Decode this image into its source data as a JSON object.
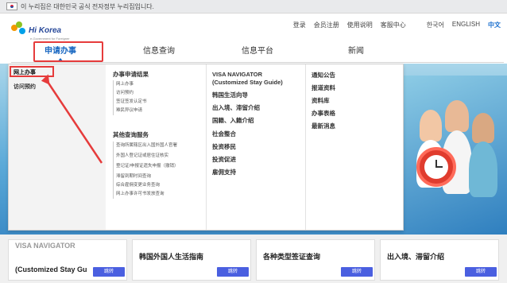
{
  "gov_bar": {
    "text": "이 누리집은 대한민국 공식 전자정부 누리집입니다."
  },
  "logo": {
    "brand": "Hi Korea",
    "tagline": "e-Government for Foreigner"
  },
  "util_links": [
    "登录",
    "会员注册",
    "使用说明",
    "客服中心",
    "한국어",
    "ENGLISH",
    "中文"
  ],
  "gnb": [
    "申请办事",
    "信息查询",
    "信息平台",
    "新闻"
  ],
  "dropdown": {
    "left_items": [
      "网上办事",
      "访问预约"
    ],
    "col2": {
      "group1_title": "办事申请结果",
      "group1_items": [
        "网上办事",
        "访问预约",
        "签证签发认定书",
        "难民异议申请"
      ],
      "group2_title": "其他查询服务",
      "group2_items": [
        "查询所属辖区出入国外国人官署",
        "外国人登记证或居住证核实",
        "登记证/申报证遗失申报（撤销）",
        "滞留到期时间查询",
        "综合雇佣变更业务查询",
        "网上办事许可书发放查询"
      ]
    },
    "col3": [
      "VISA NAVIGATOR",
      "(Customized Stay Guide)",
      "韩国生活向导",
      "出入境、滞留介绍",
      "国籍、入籍介绍",
      "社会整合",
      "投资移民",
      "投资促进",
      "雇佣支持"
    ],
    "col4": [
      "通知公告",
      "报道资料",
      "资料库",
      "办事表格",
      "最新消息"
    ]
  },
  "cards": [
    {
      "title": "VISA NAVIGATOR",
      "title2": "(Customized Stay Gu",
      "button": "跳转"
    },
    {
      "title": "韩国外国人生活指南",
      "button": "跳转"
    },
    {
      "title": "各种类型签证查询",
      "button": "跳转"
    },
    {
      "title": "出入境、滞留介绍",
      "button": "跳转"
    }
  ],
  "colors": {
    "accent": "#1565c0",
    "highlight": "#e63b3b",
    "button": "#4a5fe0"
  }
}
